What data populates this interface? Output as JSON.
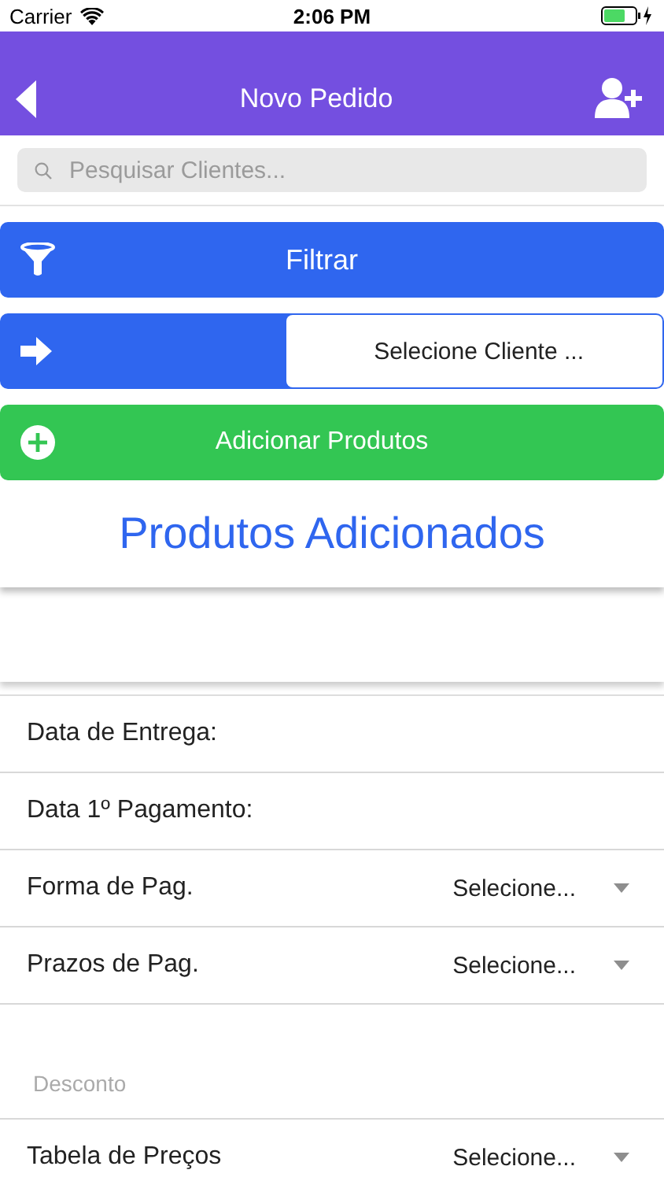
{
  "status_bar": {
    "carrier": "Carrier",
    "time": "2:06 PM"
  },
  "nav": {
    "title": "Novo Pedido"
  },
  "search": {
    "placeholder": "Pesquisar Clientes..."
  },
  "filter_button": {
    "label": "Filtrar"
  },
  "client_select": {
    "value": "Selecione Cliente ..."
  },
  "add_button": {
    "label": "Adicionar Produtos"
  },
  "products": {
    "title": "Produtos Adicionados"
  },
  "form_rows": [
    {
      "kind": "date",
      "label": "Data de Entrega:"
    },
    {
      "kind": "date",
      "label": "Data 1º Pagamento:"
    },
    {
      "kind": "select",
      "label": "Forma de Pag.",
      "value": "Selecione..."
    },
    {
      "kind": "select",
      "label": "Prazos de Pag.",
      "value": "Selecione..."
    },
    {
      "kind": "input",
      "placeholder": "Desconto"
    },
    {
      "kind": "select",
      "label": "Tabela de Preços",
      "value": "Selecione..."
    }
  ]
}
